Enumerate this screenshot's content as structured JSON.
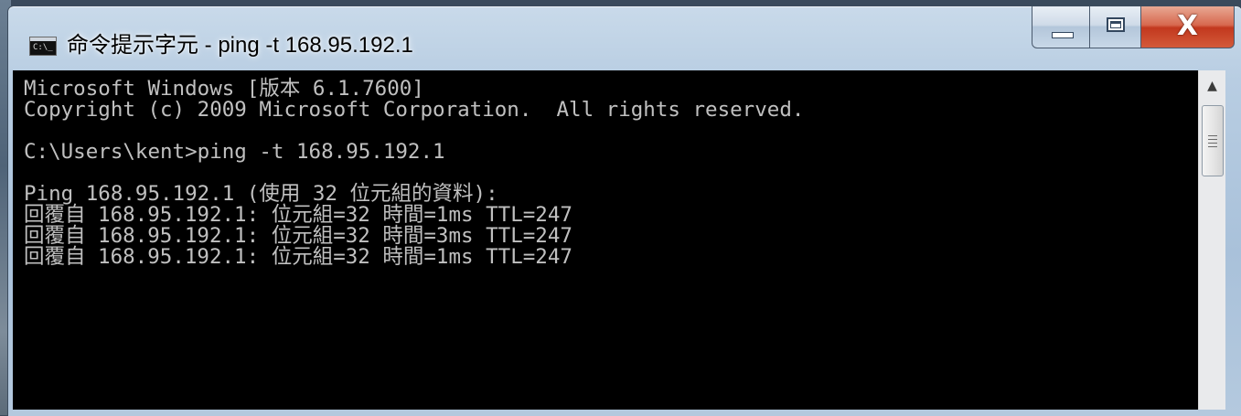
{
  "window": {
    "title": "命令提示字元 - ping  -t 168.95.192.1",
    "app_icon_text": "C:\\_",
    "controls": {
      "minimize": "minimize",
      "maximize": "maximize",
      "close_glyph": "X"
    }
  },
  "console": {
    "lines": [
      "Microsoft Windows [版本 6.1.7600]",
      "Copyright (c) 2009 Microsoft Corporation.  All rights reserved.",
      "",
      "C:\\Users\\kent>ping -t 168.95.192.1",
      "",
      "Ping 168.95.192.1 (使用 32 位元組的資料):",
      "回覆自 168.95.192.1: 位元組=32 時間=1ms TTL=247",
      "回覆自 168.95.192.1: 位元組=32 時間=3ms TTL=247",
      "回覆自 168.95.192.1: 位元組=32 時間=1ms TTL=247"
    ]
  },
  "scrollbar": {
    "up_arrow": "▲"
  },
  "colors": {
    "console_bg": "#000000",
    "console_fg": "#c0c0c0",
    "close_red": "#c2381e",
    "titlebar_blue": "#b8cde2"
  },
  "icons": [
    "cmd-app-icon",
    "minimize-icon",
    "maximize-icon",
    "close-icon",
    "scroll-up-arrow-icon",
    "scroll-grip-icon"
  ]
}
